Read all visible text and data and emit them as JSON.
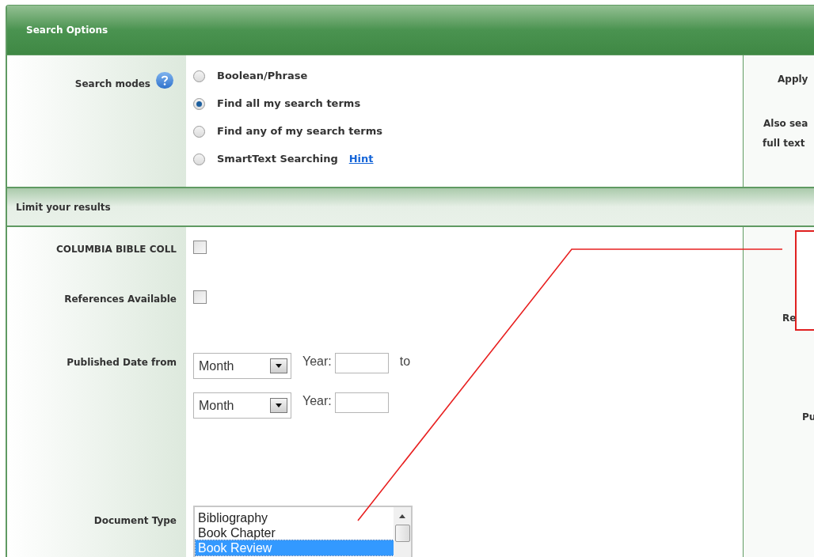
{
  "header": {
    "title": "Search Options"
  },
  "search_modes": {
    "label": "Search modes",
    "options": [
      {
        "label": "Boolean/Phrase",
        "selected": false
      },
      {
        "label": "Find all my search terms",
        "selected": true
      },
      {
        "label": "Find any of my search terms",
        "selected": false
      },
      {
        "label": "SmartText Searching",
        "selected": false,
        "link": "Hint"
      }
    ]
  },
  "side_panel_top": {
    "lines": [
      "Apply",
      "Also sea",
      "full text"
    ]
  },
  "limits": {
    "title": "Limit your results",
    "rows": [
      {
        "kind": "checkbox",
        "label": "COLUMBIA BIBLE COLL",
        "checked": false
      },
      {
        "kind": "checkbox",
        "label": "References Available",
        "checked": false
      },
      {
        "kind": "date",
        "label": "Published Date from",
        "ranges": [
          {
            "month": "Month",
            "year_label": "Year:",
            "connector": "to"
          },
          {
            "month": "Month",
            "year_label": "Year:"
          }
        ]
      },
      {
        "kind": "list",
        "label": "Document Type",
        "items": [
          {
            "label": "Bibliography",
            "selected": false
          },
          {
            "label": "Book Chapter",
            "selected": false
          },
          {
            "label": "Book Review",
            "selected": true
          }
        ]
      }
    ]
  },
  "side_panel_bottom": {
    "lines": [
      "Re",
      "Pu"
    ]
  }
}
